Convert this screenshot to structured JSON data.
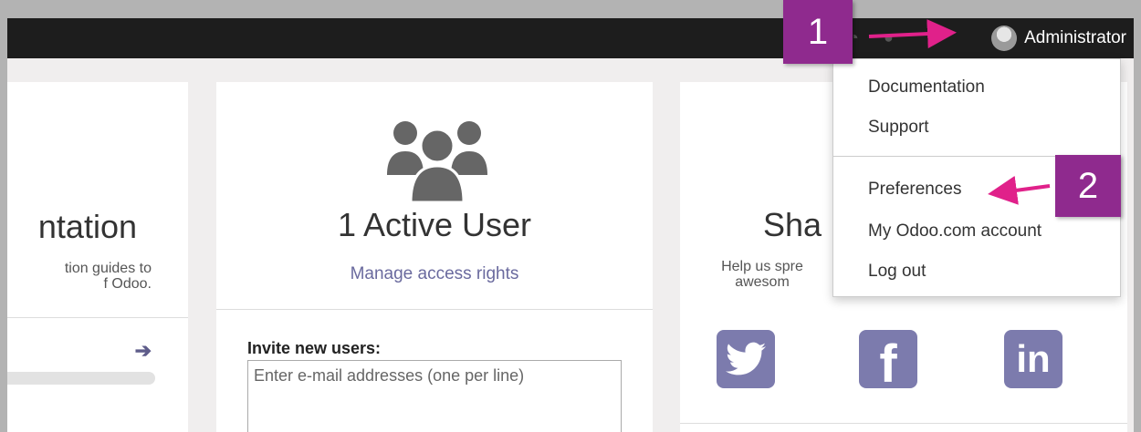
{
  "topbar": {
    "user_name": "Administrator"
  },
  "user_dropdown": {
    "items": [
      "Documentation",
      "Support",
      "Preferences",
      "My Odoo.com account",
      "Log out"
    ]
  },
  "cards": {
    "documentation": {
      "title": "ntation",
      "desc_line1": "tion guides to",
      "desc_line2": "f Odoo.",
      "arrow": "➔"
    },
    "users": {
      "title": "1 Active User",
      "link": "Manage access rights",
      "invite_label": "Invite new users:",
      "invite_placeholder": "Enter e-mail addresses (one per line)"
    },
    "share": {
      "title": "Sha",
      "desc_line1": "Help us spre",
      "desc_line2": "awesom",
      "social": {
        "facebook": "f",
        "linkedin": "in"
      }
    }
  },
  "annotations": {
    "callout_1": "1",
    "callout_2": "2"
  },
  "colors": {
    "topbar": "#1d1d1d",
    "accent": "#7c7bad",
    "link": "#6a6a9e",
    "callout": "#8f2a8e",
    "arrow": "#e0218a"
  },
  "icons": [
    "users-group-icon",
    "twitter-icon",
    "facebook-icon",
    "linkedin-icon",
    "avatar",
    "arrow-right-icon"
  ]
}
